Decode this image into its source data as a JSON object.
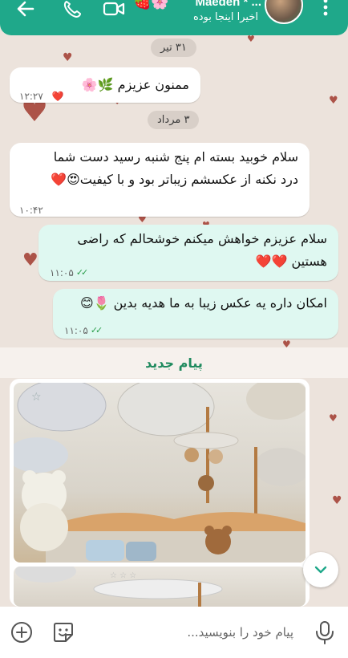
{
  "header": {
    "contact_name": "Maedeh * ...",
    "status": "اخیرا اینجا بوده",
    "name_emoji": "🍓🌸"
  },
  "messages": [
    {
      "type": "date",
      "text": "۳۱ تیر"
    },
    {
      "type": "in",
      "text": "ممنون عزیزم 🌿🌸",
      "time": "۱۲:۲۷",
      "reaction": "❤️"
    },
    {
      "type": "date",
      "text": "۳ مرداد"
    },
    {
      "type": "in",
      "lines": [
        "سلام خوبید بسته ام پنج شنبه رسید دست شما",
        "درد نکنه از عکسشم زیباتر بود و با کیفیت😍❤️"
      ],
      "time": "۱۰:۴۲"
    },
    {
      "type": "out",
      "lines": [
        "سلام عزیزم خواهش میکنم خوشحالم که راضی",
        "هستین ❤️❤️"
      ],
      "time": "۱۱:۰۵"
    },
    {
      "type": "out",
      "text": "امکان داره یه عکس زیبا به ما هدیه بدین 🌷😊",
      "time": "۱۱:۰۵"
    }
  ],
  "new_messages_label": "پیام جدید",
  "composer": {
    "placeholder": "پیام خود را بنویسید..."
  },
  "colors": {
    "header_bg": "#1fa88a",
    "chat_bg": "#ece3dc",
    "outgoing_bubble": "#dff8f1",
    "incoming_bubble": "#ffffff",
    "accent_green": "#1f8a5e"
  },
  "icons": [
    "back-arrow-icon",
    "call-icon",
    "video-call-icon",
    "more-menu-icon",
    "chevron-down-icon",
    "add-icon",
    "sticker-icon",
    "microphone-icon",
    "double-check-icon"
  ]
}
